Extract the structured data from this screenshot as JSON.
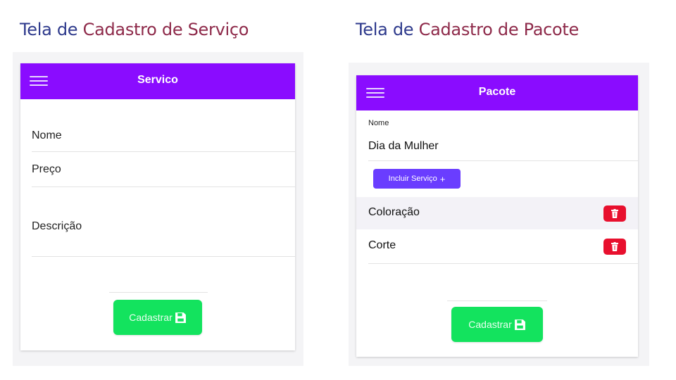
{
  "screens": {
    "servico": {
      "heading_part1": "Tela de",
      "heading_part2": "Cadastro de Serviço",
      "appbar_title": "Servico",
      "fields": [
        "Nome",
        "Preço",
        "Descrição"
      ],
      "submit_label": "Cadastrar",
      "icons": {
        "menu": "hamburger-icon",
        "submit": "floppy-disk-icon"
      }
    },
    "pacote": {
      "heading_part1": "Tela de",
      "heading_part2": "Cadastro de Pacote",
      "appbar_title": "Pacote",
      "name_label": "Nome",
      "name_value": "Dia da Mulher",
      "add_service_label": "Incluir Serviço",
      "add_service_symbol": "+",
      "services": [
        "Coloração",
        "Corte"
      ],
      "submit_label": "Cadastrar",
      "icons": {
        "menu": "hamburger-icon",
        "delete": "trash-icon",
        "submit": "floppy-disk-icon"
      }
    }
  },
  "colors": {
    "appbar": "#8a0cff",
    "submit_button": "#13e35e",
    "add_button": "#6a3dff",
    "delete_button": "#e8102e",
    "heading_primary": "#2e3a8c",
    "heading_accent": "#8e2a4a"
  }
}
